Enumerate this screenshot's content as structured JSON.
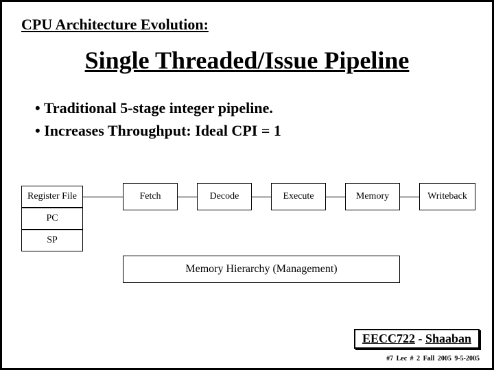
{
  "overline": "CPU Architecture Evolution:",
  "title": "Single Threaded/Issue Pipeline",
  "bullets": [
    "Traditional 5-stage integer pipeline.",
    "Increases Throughput:  Ideal CPI = 1"
  ],
  "diagram": {
    "registers": [
      "Register File",
      "PC",
      "SP"
    ],
    "stages": [
      "Fetch",
      "Decode",
      "Execute",
      "Memory",
      "Writeback"
    ],
    "memory_label": "Memory Hierarchy (Management)"
  },
  "footer": {
    "course_code": "EECC722",
    "dash": " - ",
    "author": "Shaaban",
    "meta": "#7   Lec # 2   Fall 2005  9-5-2005"
  }
}
